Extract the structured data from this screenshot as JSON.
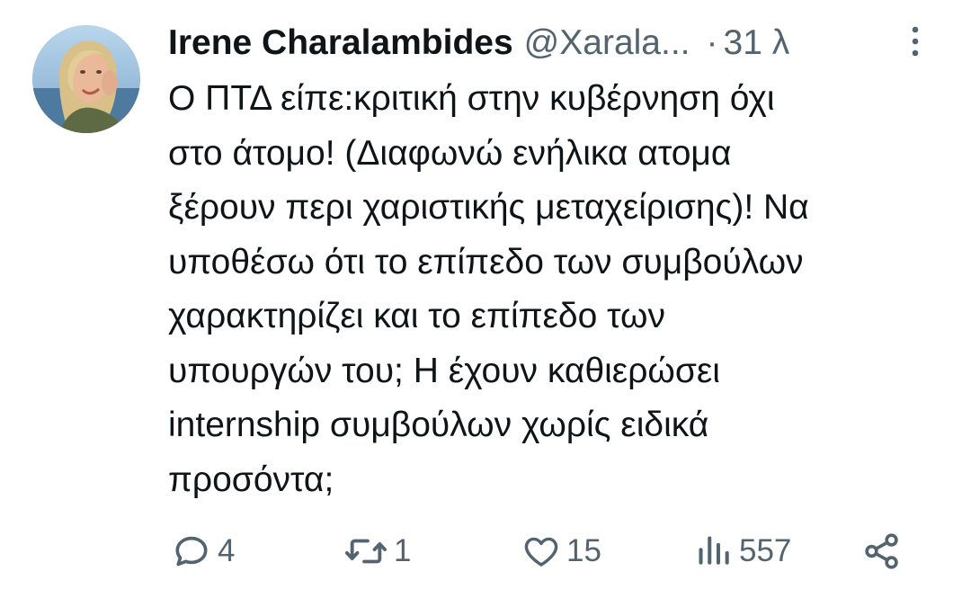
{
  "tweet": {
    "author_name": "Irene Charalambides",
    "handle": "@Xarala...",
    "separator": "·",
    "time": "31 λ",
    "text": "Ο ΠΤΔ είπε:κριτική στην κυβέρνηση όχι\nστο άτομο! (Διαφωνώ ενήλικα ατομα\nξέρουν περι χαριστικής μεταχείρισης)! Να\nυποθέσω ότι το επίπεδο των συμβούλων\nχαρακτηρίζει και το επίπεδο των\nυπουργών του; Η έχουν καθιερώσει\ninternship συμβούλων χωρίς ειδικά\nπροσόντα;"
  },
  "actions": {
    "replies": "4",
    "reposts": "1",
    "likes": "15",
    "views": "557"
  },
  "icons": {
    "reply": "reply-icon",
    "repost": "repost-icon",
    "like": "heart-icon",
    "views": "views-chart-icon",
    "share": "share-icon",
    "more": "more-vertical-icon"
  },
  "colors": {
    "text": "#0f1419",
    "secondary": "#536471",
    "background": "#ffffff"
  }
}
